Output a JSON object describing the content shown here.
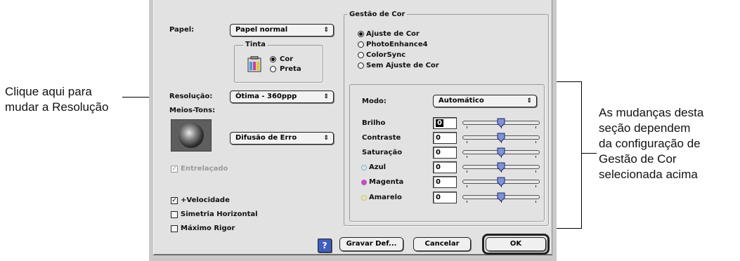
{
  "callouts": {
    "left": [
      "Clique aqui para",
      "mudar a Resolução"
    ],
    "right": [
      "As mudanças desta",
      "seção dependem",
      "da configuração de",
      "Gestão de Cor",
      "selecionada acima"
    ]
  },
  "left_panel": {
    "papel_label": "Papel:",
    "papel_value": "Papel normal",
    "tinta_label": "Tinta",
    "tinta_options": [
      "Cor",
      "Preta"
    ],
    "tinta_selected": "Cor",
    "resolucao_label": "Resolução:",
    "resolucao_value": "Ótima - 360ppp",
    "meios_tons_label": "Meios-Tons:",
    "meios_tons_value": "Difusão de Erro",
    "entrelacado_label": "Entrelaçado",
    "entrelacado_checked": true,
    "velocidade_label": "+Velocidade",
    "velocidade_checked": true,
    "simetria_label": "Simetria Horizontal",
    "maximo_label": "Máximo Rigor"
  },
  "color_management": {
    "title": "Gestão de Cor",
    "options": [
      "Ajuste de Cor",
      "PhotoEnhance4",
      "ColorSync",
      "Sem Ajuste de Cor"
    ],
    "selected": "Ajuste de Cor",
    "modo_label": "Modo:",
    "modo_value": "Automático",
    "sliders": [
      {
        "label": "Brilho",
        "value": "0",
        "level": 0.5
      },
      {
        "label": "Contraste",
        "value": "0",
        "level": 0.5
      },
      {
        "label": "Saturação",
        "value": "0",
        "level": 0.5
      },
      {
        "label": "Azul",
        "value": "0",
        "level": 0.5,
        "color": "#6fb7d6"
      },
      {
        "label": "Magenta",
        "value": "0",
        "level": 0.5,
        "color": "#c04fc0"
      },
      {
        "label": "Amarelo",
        "value": "0",
        "level": 0.5,
        "color": "#d8c63a"
      }
    ]
  },
  "buttons": {
    "help": "?",
    "save": "Gravar Def...",
    "cancel": "Cancelar",
    "ok": "OK"
  },
  "colors": {
    "dialog_bg": "#e2e2e2",
    "thumb": "#7d93d6"
  }
}
